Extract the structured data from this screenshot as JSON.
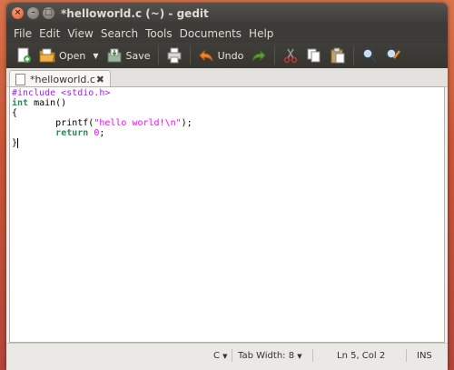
{
  "window": {
    "title": "*helloworld.c (~) - gedit"
  },
  "menu": [
    "File",
    "Edit",
    "View",
    "Search",
    "Tools",
    "Documents",
    "Help"
  ],
  "toolbar": {
    "open_label": "Open",
    "save_label": "Save",
    "undo_label": "Undo"
  },
  "tab": {
    "label": "*helloworld.c"
  },
  "code": {
    "line1_pp": "#include <stdio.h>",
    "line2_kw": "int",
    "line2_rest": " main()",
    "line3": "{",
    "line4_pre": "        printf(",
    "line4_str": "\"hello world!\\n\"",
    "line4_post": ");",
    "line5_indent": "        ",
    "line5_kw": "return",
    "line5_num": "0",
    "line5_post": ";",
    "line6": "}"
  },
  "status": {
    "language": "C",
    "tab_width": "Tab Width: 8",
    "position": "Ln 5, Col 2",
    "mode": "INS"
  },
  "colors": {
    "titlebar": "#3c3b37",
    "close_button": "#e2572b",
    "preprocessor": "#a020f0",
    "keyword": "#2e8b57",
    "string": "#ff00ff"
  }
}
